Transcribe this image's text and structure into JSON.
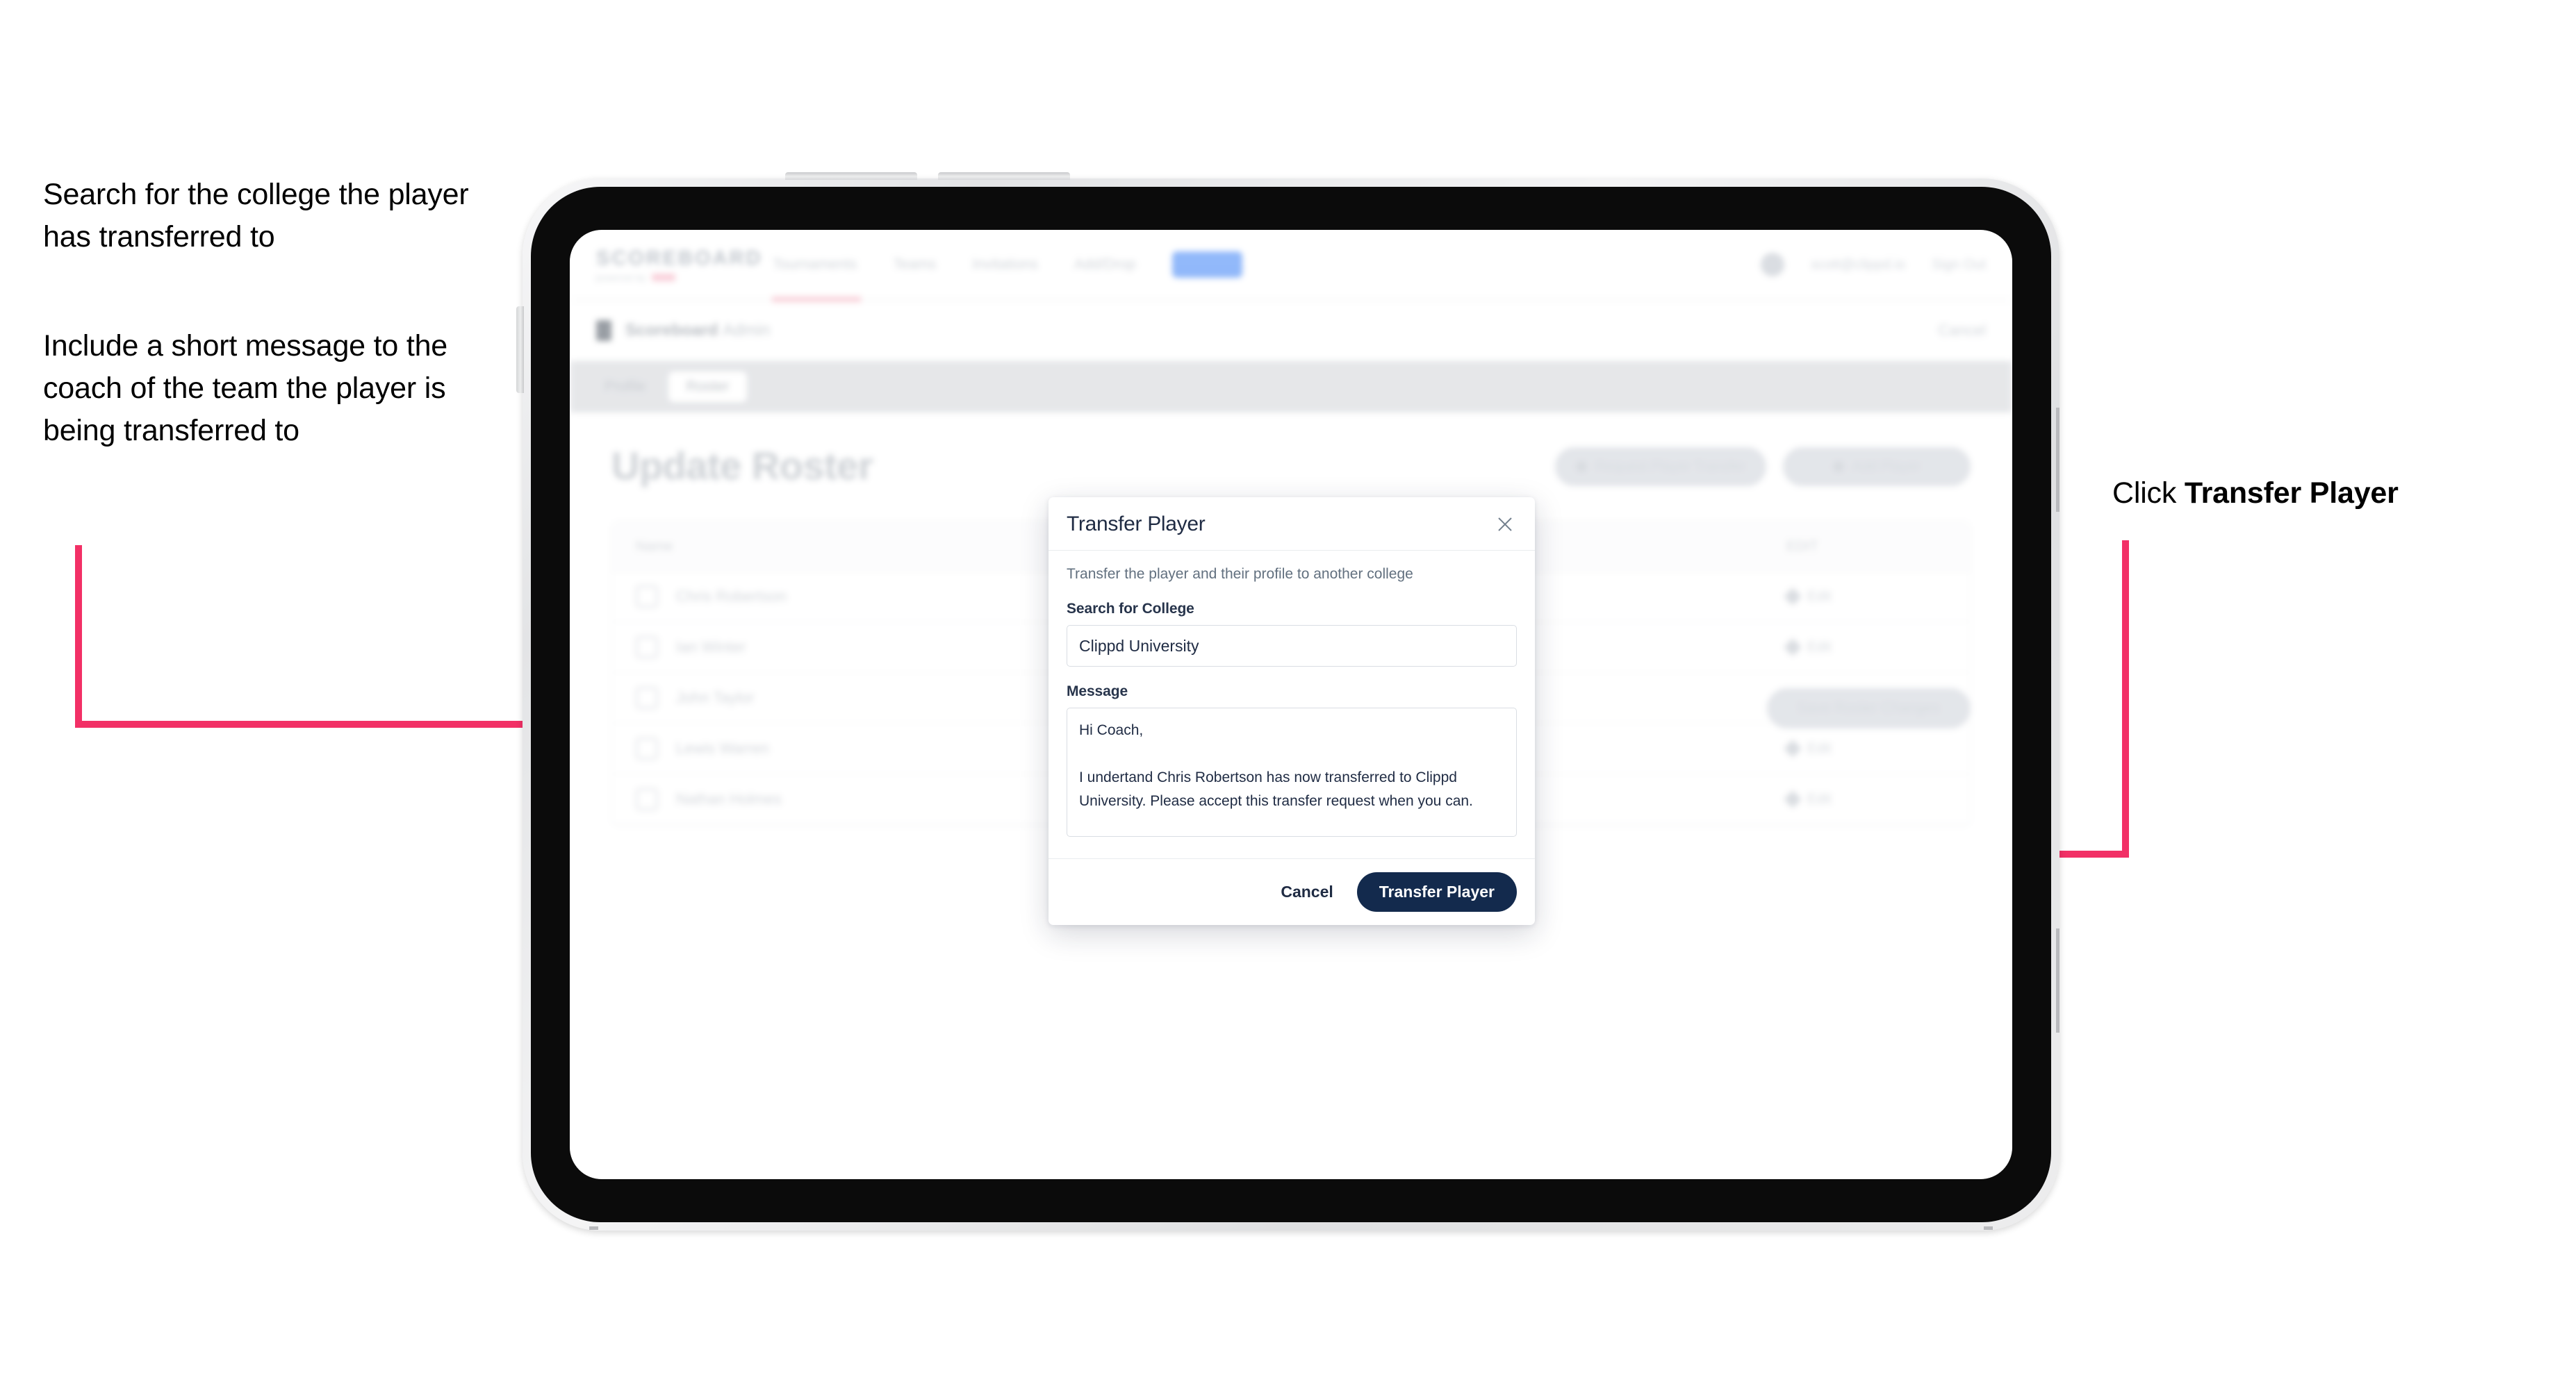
{
  "annotations": {
    "left_top": "Search for the college the player has transferred to",
    "left_bottom": "Include a short message to the coach of the team the player is being transferred to",
    "right_prefix": "Click ",
    "right_bold": "Transfer Player"
  },
  "colors": {
    "arrow_pink": "#F23066",
    "primary_navy": "#132A4D",
    "modal_border": "#D9DDE3"
  },
  "app": {
    "logo": {
      "main": "SCOREBOARD",
      "sub": "powered by",
      "dot": "clippd"
    },
    "nav": [
      "Tournaments",
      "Teams",
      "Invitations",
      "Add/Drop",
      "Roster"
    ],
    "header_right": {
      "user": "scott@clippd.io",
      "signout": "Sign Out"
    },
    "subbar": {
      "title": "Scoreboard",
      "title_muted": "Admin",
      "right": "Cancel"
    },
    "tabs": [
      {
        "label": "Profile",
        "active": false
      },
      {
        "label": "Roster",
        "active": true
      }
    ],
    "page_title": "Update Roster",
    "actions": [
      "Request Player Transfer",
      "Add Player"
    ],
    "table": {
      "columns": [
        "Name",
        "EDIT"
      ],
      "rows": [
        {
          "name": "Chris Robertson",
          "edit": "Edit"
        },
        {
          "name": "Ian Winter",
          "edit": "Edit"
        },
        {
          "name": "John Taylor",
          "edit": "Edit"
        },
        {
          "name": "Lewis Warren",
          "edit": "Edit"
        },
        {
          "name": "Nathan Holmes",
          "edit": "Edit"
        }
      ]
    },
    "bottom_cta": "Save Roster Changes"
  },
  "modal": {
    "title": "Transfer Player",
    "close_icon": "close-icon",
    "description": "Transfer the player and their profile to another college",
    "college_label": "Search for College",
    "college_value": "Clippd University",
    "college_placeholder": "Search for College",
    "message_label": "Message",
    "message_value": "Hi Coach,\n\nI undertand Chris Robertson has now transferred to Clippd University. Please accept this transfer request when you can.",
    "message_placeholder": "Message",
    "cancel_label": "Cancel",
    "submit_label": "Transfer Player"
  }
}
